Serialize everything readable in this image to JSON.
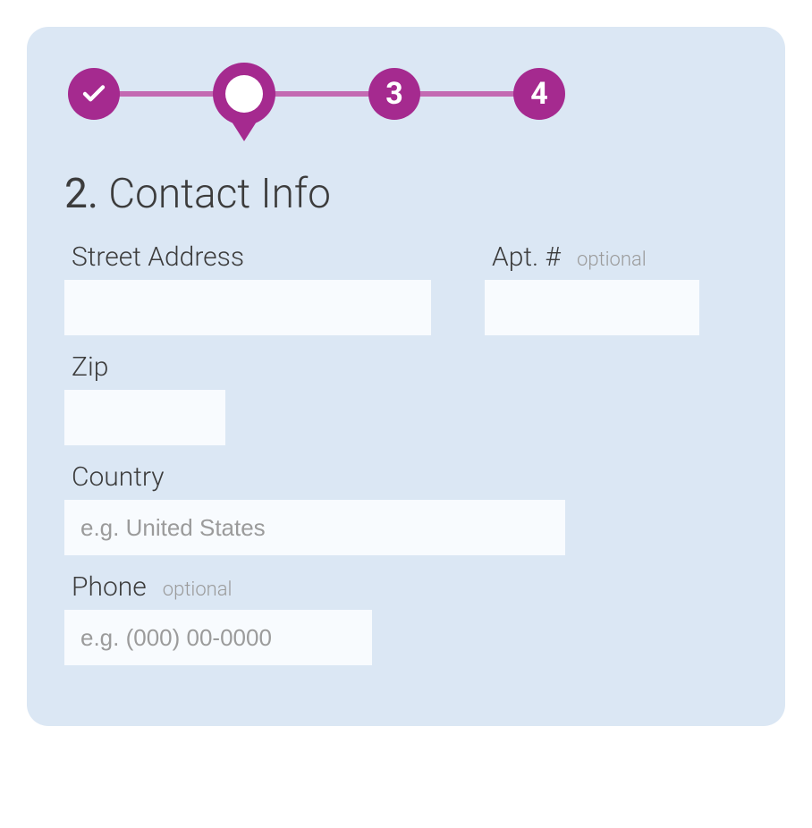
{
  "stepper": {
    "step3_label": "3",
    "step4_label": "4"
  },
  "title": {
    "number": "2.",
    "text": "Contact Info"
  },
  "fields": {
    "street": {
      "label": "Street Address",
      "placeholder": "",
      "value": ""
    },
    "apt": {
      "label": "Apt. #",
      "optional": "optional",
      "placeholder": "",
      "value": ""
    },
    "zip": {
      "label": "Zip",
      "placeholder": "",
      "value": ""
    },
    "country": {
      "label": "Country",
      "placeholder": "e.g. United States",
      "value": ""
    },
    "phone": {
      "label": "Phone",
      "optional": "optional",
      "placeholder": "e.g. (000) 00-0000",
      "value": ""
    }
  }
}
